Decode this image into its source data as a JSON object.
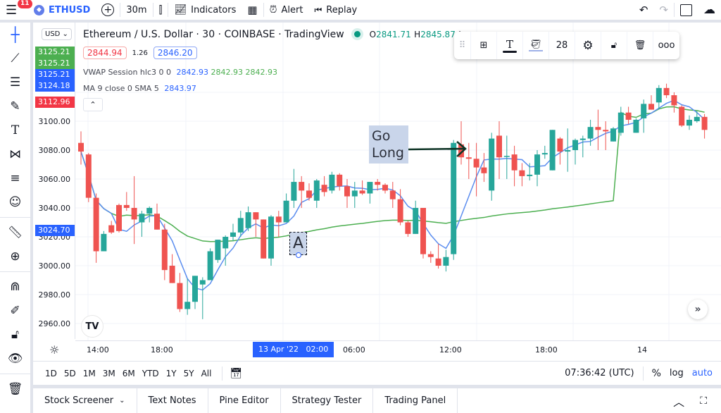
{
  "topbar": {
    "menu_badge": "11",
    "symbol": "ETHUSD",
    "interval": "30m",
    "indicators_label": "Indicators",
    "alert_label": "Alert",
    "replay_label": "Replay"
  },
  "legend": {
    "title": "Ethereum / U.S. Dollar · 30 · COINBASE · TradingView",
    "open_label": "O",
    "open_value": "2841.71",
    "high_label": "H",
    "high_value": "2845.87",
    "low_label": "L",
    "sell_price": "2844.94",
    "spread": "1.26",
    "buy_price": "2846.20",
    "vwap_label": "VWAP Session hlc3 0 0",
    "vwap_values": [
      "2842.93",
      "2842.93",
      "2842.93"
    ],
    "ma_label": "MA 9 close 0 SMA 5",
    "ma_value": "2843.97"
  },
  "price_scale": {
    "currency": "USD",
    "tags": [
      {
        "value": "3125.21",
        "color": "#4caf50"
      },
      {
        "value": "3125.21",
        "color": "#4caf50"
      },
      {
        "value": "3125.21",
        "color": "#2962ff"
      },
      {
        "value": "3124.18",
        "color": "#2962ff"
      },
      {
        "value": "3112.96",
        "color": "#f23645"
      }
    ],
    "crosshair_price": "3024.70",
    "ticks": [
      "3100.00",
      "3080.00",
      "3060.00",
      "3040.00",
      "3020.00",
      "3000.00",
      "2980.00",
      "2960.00"
    ]
  },
  "time_axis": {
    "ticks": [
      "14:00",
      "18:00",
      "06:00",
      "12:00",
      "18:00",
      "14"
    ],
    "crosshair_time": "13 Apr '22   02:00"
  },
  "drawing_toolbar": {
    "font_size": "28"
  },
  "annotations": {
    "text_box": "A",
    "callout_line1": "Go",
    "callout_line2": "Long"
  },
  "bottom_bar": {
    "ranges": [
      "1D",
      "5D",
      "1M",
      "3M",
      "6M",
      "YTD",
      "1Y",
      "5Y",
      "All"
    ],
    "clock": "07:36:42 (UTC)",
    "percent_label": "%",
    "log_label": "log",
    "auto_label": "auto"
  },
  "panels": [
    "Stock Screener",
    "Text Notes",
    "Pine Editor",
    "Strategy Tester",
    "Trading Panel"
  ],
  "colors": {
    "up": "#26a69a",
    "down": "#ef5350",
    "vwap": "#4caf50",
    "ma": "#5b8def",
    "accent": "#2962ff"
  },
  "chart_data": {
    "type": "candlestick",
    "title": "Ethereum / U.S. Dollar · 30 · COINBASE",
    "ylim": [
      2950,
      3130
    ],
    "candles": [
      [
        3085,
        3093,
        3070,
        3079
      ],
      [
        3077,
        3078,
        3044,
        3047
      ],
      [
        3047,
        3050,
        3002,
        3010
      ],
      [
        3010,
        3024,
        3011,
        3022
      ],
      [
        3028,
        3031,
        3022,
        3023
      ],
      [
        3042,
        3043,
        3023,
        3024
      ],
      [
        3042,
        3051,
        3038,
        3040
      ],
      [
        3040,
        3062,
        3015,
        3032
      ],
      [
        3030,
        3038,
        3020,
        3036
      ],
      [
        3036,
        3041,
        3030,
        3040
      ],
      [
        3036,
        3043,
        3025,
        3025
      ],
      [
        3025,
        3029,
        2990,
        2997
      ],
      [
        3000,
        3008,
        2992,
        2988
      ],
      [
        2988,
        2995,
        2968,
        2970
      ],
      [
        2970,
        2991,
        2966,
        2975
      ],
      [
        2975,
        2991,
        2970,
        2993
      ],
      [
        2987,
        2992,
        2963,
        2990
      ],
      [
        2990,
        3012,
        2998,
        3010
      ],
      [
        3004,
        3018,
        3002,
        3018
      ],
      [
        3012,
        3021,
        3000,
        3020
      ],
      [
        3020,
        3029,
        3017,
        3023
      ],
      [
        3023,
        3038,
        3020,
        3033
      ],
      [
        3026,
        3041,
        3024,
        3037
      ],
      [
        3037,
        3033,
        3020,
        3032
      ],
      [
        3032,
        3030,
        3010,
        3005
      ],
      [
        3005,
        3035,
        3000,
        3034
      ],
      [
        3034,
        3038,
        3020,
        3030
      ],
      [
        3030,
        3050,
        3030,
        3045
      ],
      [
        3045,
        3067,
        3040,
        3058
      ],
      [
        3058,
        3062,
        3040,
        3052
      ],
      [
        3052,
        3057,
        3045,
        3047
      ],
      [
        3045,
        3060,
        3040,
        3059
      ],
      [
        3056,
        3062,
        3048,
        3051
      ],
      [
        3052,
        3065,
        3050,
        3063
      ],
      [
        3063,
        3064,
        3052,
        3055
      ],
      [
        3055,
        3060,
        3040,
        3048
      ],
      [
        3048,
        3058,
        3040,
        3052
      ],
      [
        3052,
        3059,
        3049,
        3050
      ],
      [
        3050,
        3058,
        3043,
        3058
      ],
      [
        3058,
        3060,
        3052,
        3056
      ],
      [
        3056,
        3057,
        3050,
        3052
      ],
      [
        3052,
        3058,
        3040,
        3046
      ],
      [
        3046,
        3053,
        3028,
        3030
      ],
      [
        3030,
        3031,
        3020,
        3022
      ],
      [
        3022,
        3045,
        3023,
        3040
      ],
      [
        3040,
        3040,
        3005,
        3008
      ],
      [
        3008,
        3010,
        3002,
        3006
      ],
      [
        3005,
        3015,
        2998,
        3000
      ],
      [
        3000,
        3011,
        2996,
        3006
      ],
      [
        3008,
        3087,
        3004,
        3085
      ],
      [
        3084,
        3100,
        3070,
        3075
      ],
      [
        3075,
        3085,
        3060,
        3074
      ],
      [
        3074,
        3085,
        3048,
        3068
      ],
      [
        3068,
        3078,
        3058,
        3064
      ],
      [
        3052,
        3092,
        3045,
        3088
      ],
      [
        3090,
        3100,
        3060,
        3075
      ],
      [
        3076,
        3090,
        3060,
        3076
      ],
      [
        3077,
        3083,
        3055,
        3066
      ],
      [
        3066,
        3071,
        3055,
        3062
      ],
      [
        3062,
        3071,
        3059,
        3063
      ],
      [
        3063,
        3080,
        3055,
        3077
      ],
      [
        3077,
        3083,
        3074,
        3078
      ],
      [
        3066,
        3087,
        3066,
        3094
      ],
      [
        3088,
        3089,
        3070,
        3079
      ],
      [
        3079,
        3095,
        3065,
        3080
      ],
      [
        3080,
        3088,
        3070,
        3087
      ],
      [
        3087,
        3090,
        3075,
        3088
      ],
      [
        3088,
        3101,
        3083,
        3096
      ],
      [
        3096,
        3108,
        3080,
        3094
      ],
      [
        3094,
        3100,
        3080,
        3093
      ],
      [
        3086,
        3096,
        3090,
        3095
      ],
      [
        3092,
        3110,
        3090,
        3106
      ],
      [
        3106,
        3110,
        3098,
        3101
      ],
      [
        3092,
        3102,
        3098,
        3101
      ],
      [
        3102,
        3115,
        3092,
        3112
      ],
      [
        3112,
        3118,
        3108,
        3108
      ],
      [
        3113,
        3125,
        3108,
        3123
      ],
      [
        3123,
        3126,
        3116,
        3118
      ],
      [
        3118,
        3120,
        3106,
        3111
      ],
      [
        3110,
        3111,
        3096,
        3097
      ],
      [
        3097,
        3104,
        3094,
        3101
      ],
      [
        3100,
        3107,
        3099,
        3103
      ],
      [
        3103,
        3105,
        3088,
        3094
      ]
    ]
  }
}
